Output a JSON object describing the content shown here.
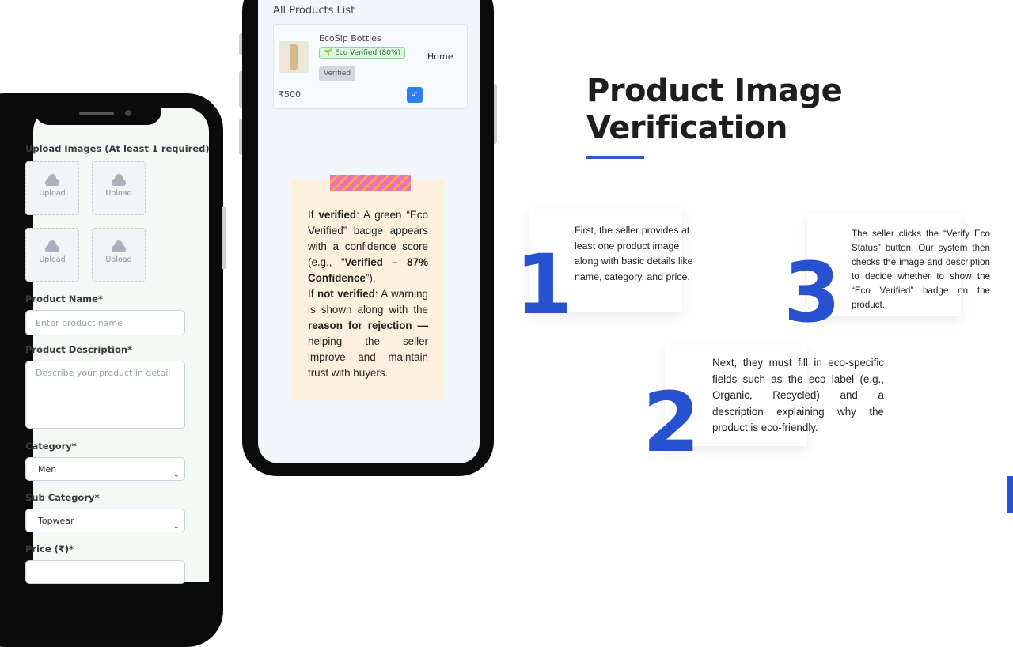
{
  "form": {
    "upload_label": "Upload Images (At least 1 required)",
    "upload_button": "Upload",
    "product_name_label": "Product Name*",
    "product_name_placeholder": "Enter product name",
    "description_label": "Product Description*",
    "description_placeholder": "Describe your product in detail",
    "category_label": "Category*",
    "category_value": "Men",
    "subcategory_label": "Sub Category*",
    "subcategory_value": "Topwear",
    "price_label": "Price (₹)*"
  },
  "product_list": {
    "title": "All Products List",
    "product": {
      "name": "EcoSip Bottles",
      "eco_badge": "🌱 Eco Verified (80%)",
      "status": "Verified",
      "category": "Home",
      "price": "₹500",
      "checked": true
    }
  },
  "note": {
    "p1_a": "If ",
    "p1_b": "verified",
    "p1_c": ": A green “Eco Verified” badge appears with a confidence score (e.g., “",
    "p1_d": "Verified – 87% Confidence",
    "p1_e": "”).",
    "p2_a": "If ",
    "p2_b": "not verified",
    "p2_c": ": A warning is shown along with the ",
    "p2_d": "reason for rejection —",
    "p2_e": " helping the seller improve and maintain trust with buyers."
  },
  "slide": {
    "title_line1": "Product Image",
    "title_line2": "Verification",
    "accent_color": "#2851cf",
    "steps": [
      {
        "number": "1",
        "text": "First, the seller provides at least one product image along with basic details like name, category, and price."
      },
      {
        "number": "2",
        "text": "Next, they must fill in eco-specific fields such as the eco label (e.g., Organic, Recycled) and a description explaining why the product is eco-friendly."
      },
      {
        "number": "3",
        "text": "The seller clicks the “Verify Eco Status” button. Our system then checks the image and description to decide whether to show the “Eco Verified” badge on the product."
      }
    ]
  }
}
